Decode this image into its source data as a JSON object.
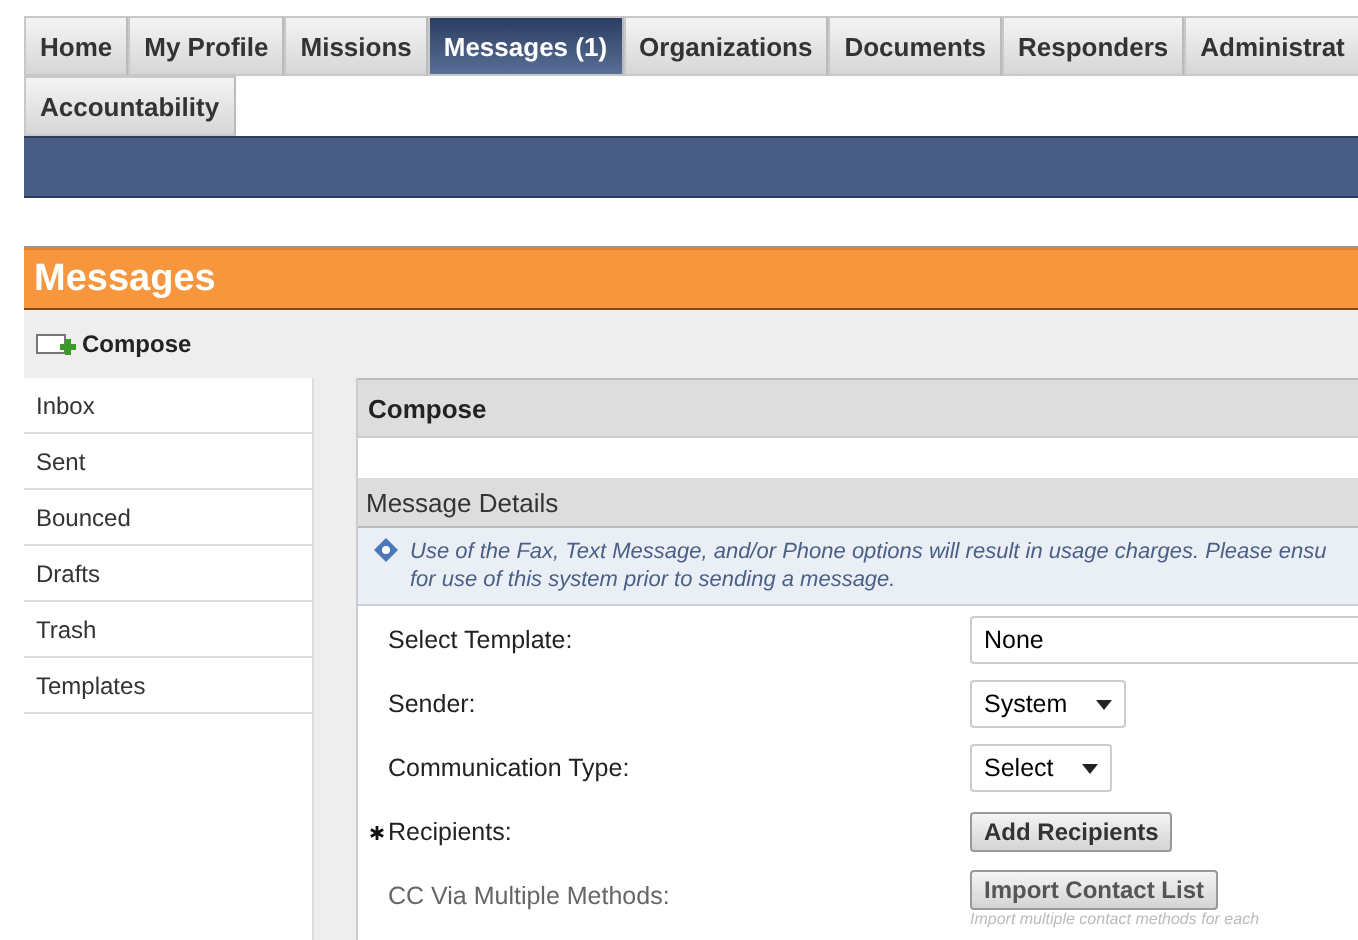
{
  "tabs": [
    {
      "label": "Home",
      "selected": false
    },
    {
      "label": "My Profile",
      "selected": false
    },
    {
      "label": "Missions",
      "selected": false
    },
    {
      "label": "Messages (1)",
      "selected": true
    },
    {
      "label": "Organizations",
      "selected": false
    },
    {
      "label": "Documents",
      "selected": false
    },
    {
      "label": "Responders",
      "selected": false
    },
    {
      "label": "Administrat",
      "selected": false
    },
    {
      "label": "Accountability",
      "selected": false
    }
  ],
  "page_title": "Messages",
  "toolbar": {
    "compose": "Compose"
  },
  "sidebar": {
    "items": [
      {
        "label": "Inbox",
        "selected": false
      },
      {
        "label": "Sent",
        "selected": false
      },
      {
        "label": "Bounced",
        "selected": false
      },
      {
        "label": "Drafts",
        "selected": false
      },
      {
        "label": "Trash",
        "selected": false
      },
      {
        "label": "Templates",
        "selected": false
      }
    ]
  },
  "panel": {
    "title": "Compose",
    "section": "Message Details",
    "info": "Use of the Fax, Text Message, and/or Phone options will result in usage charges. Please ensu",
    "info_2": "for use of this system prior to sending a message.",
    "rows": [
      {
        "label": "Select Template:",
        "kind": "text",
        "value": "None",
        "required": false,
        "disabled": false
      },
      {
        "label": "Sender:",
        "kind": "select",
        "value": "System",
        "required": false,
        "disabled": false
      },
      {
        "label": "Communication Type:",
        "kind": "select",
        "value": "Select",
        "required": false,
        "disabled": false
      },
      {
        "label": "Recipients:",
        "kind": "button",
        "value": "Add Recipients",
        "required": true,
        "disabled": false
      },
      {
        "label": "CC Via Multiple Methods:",
        "kind": "button",
        "value": "Import Contact List",
        "required": false,
        "disabled": true,
        "hint": "Import multiple contact methods for each"
      }
    ]
  }
}
